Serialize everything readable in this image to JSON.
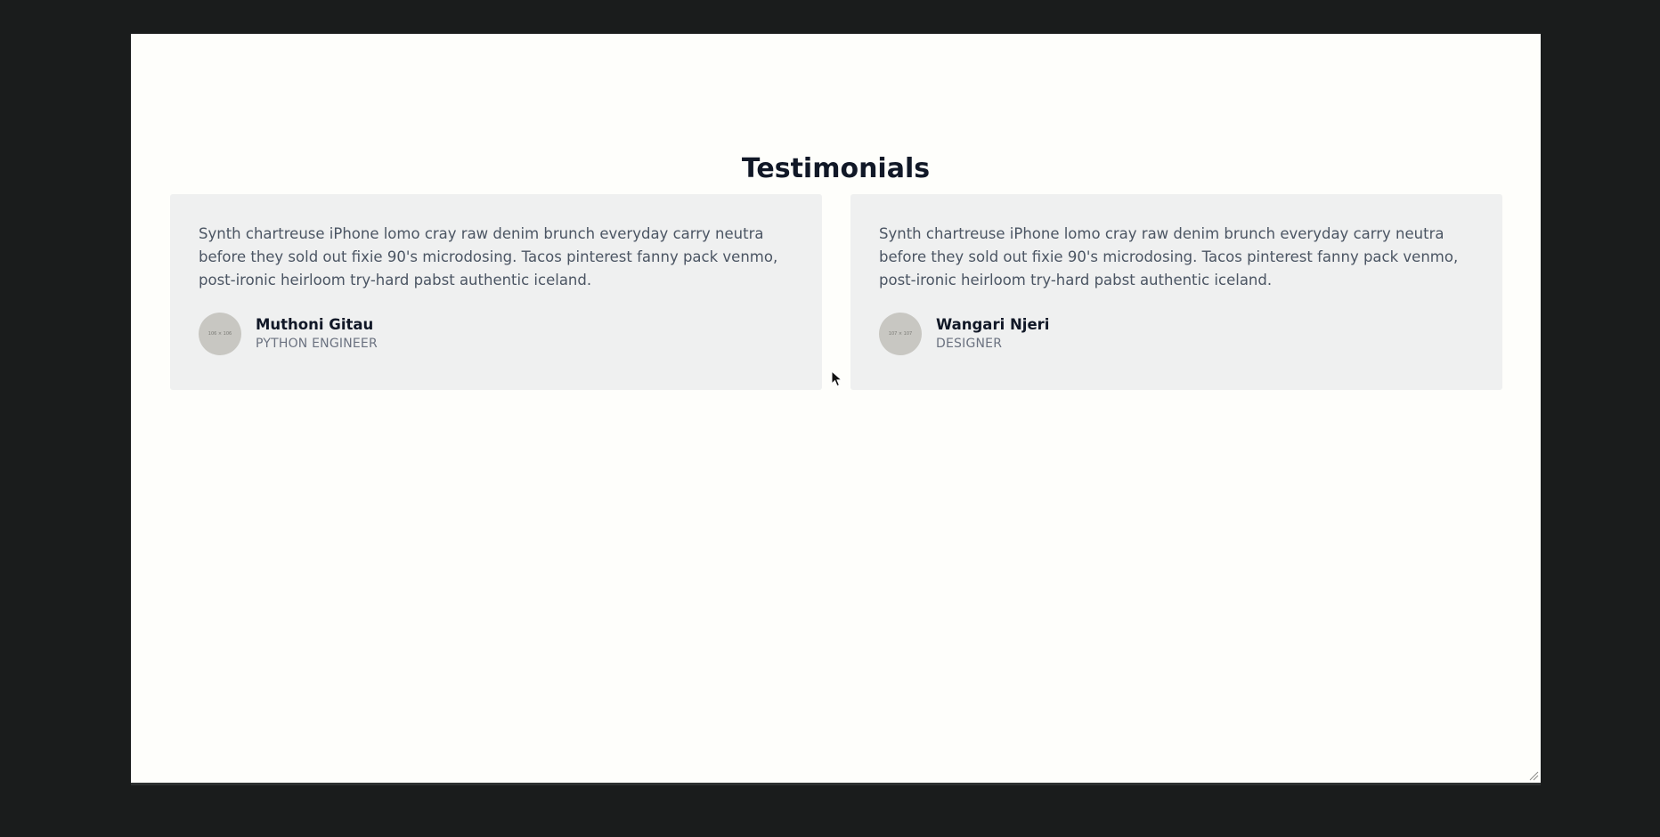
{
  "page": {
    "title": "Testimonials"
  },
  "testimonials": [
    {
      "quote": "Synth chartreuse iPhone lomo cray raw denim brunch everyday carry neutra before they sold out fixie 90's microdosing. Tacos pinterest fanny pack venmo, post-ironic heirloom try-hard pabst authentic iceland.",
      "avatar_text": "106 × 106",
      "name": "Muthoni Gitau",
      "role": "PYTHON ENGINEER"
    },
    {
      "quote": "Synth chartreuse iPhone lomo cray raw denim brunch everyday carry neutra before they sold out fixie 90's microdosing. Tacos pinterest fanny pack venmo, post-ironic heirloom try-hard pabst authentic iceland.",
      "avatar_text": "107 × 107",
      "name": "Wangari Njeri",
      "role": "DESIGNER"
    }
  ],
  "colors": {
    "background": "#1a1c1c",
    "page": "#fefefb",
    "card": "#eff0f0",
    "heading": "#111827",
    "body_text": "#4b5563",
    "muted_text": "#6b7280",
    "avatar": "#c8c7c2"
  },
  "icons": {
    "cursor": "mouse-pointer-icon",
    "resize": "resize-grip-icon"
  }
}
